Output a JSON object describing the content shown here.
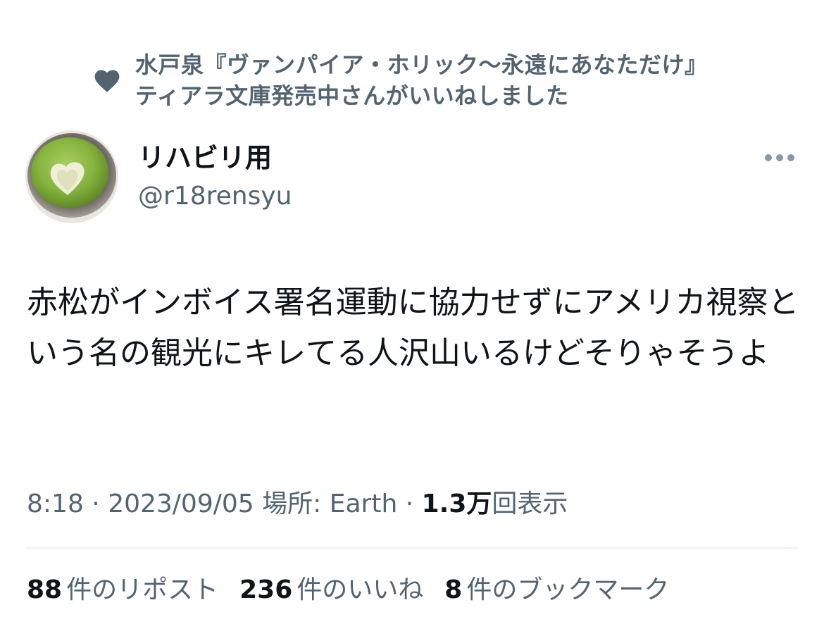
{
  "social_context": {
    "icon": "heart-icon",
    "line1": "水戸泉『ヴァンパイア・ホリック〜永遠にあなただけ』",
    "line2": "ティアラ文庫発売中さんがいいねしました"
  },
  "author": {
    "display_name": "リハビリ用",
    "handle": "@r18rensyu",
    "avatar_icon": "matcha-latte-avatar"
  },
  "more_icon": "more-icon",
  "tweet": {
    "text": "赤松がインボイス署名運動に協力せずにアメリカ視察という名の観光にキレてる人沢山いるけどそりゃそうよ"
  },
  "meta": {
    "time": "8:18",
    "sep1": " · ",
    "date": "2023/09/05",
    "location_prefix": " 場所: ",
    "location": "Earth",
    "sep2": " · ",
    "views_count": "1.3万",
    "views_label": "回表示"
  },
  "stats": [
    {
      "count": "88",
      "label": "件のリポスト"
    },
    {
      "count": "236",
      "label": "件のいいね"
    },
    {
      "count": "8",
      "label": "件のブックマーク"
    }
  ],
  "colors": {
    "primary_text": "#0f1419",
    "secondary_text": "#536471",
    "divider": "#eff3f4"
  }
}
